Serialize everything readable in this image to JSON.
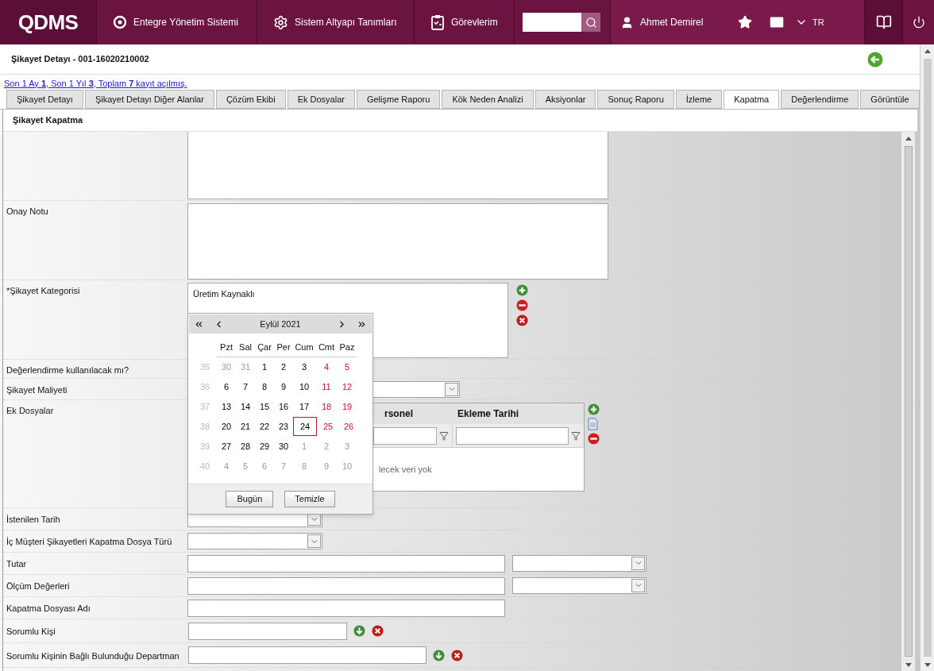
{
  "header": {
    "logo": "QDMS",
    "nav": [
      {
        "label": "Entegre Yönetim Sistemi"
      },
      {
        "label": "Sistem Altyapı Tanımları"
      },
      {
        "label": "Görevlerim"
      }
    ],
    "user": "Ahmet Demirel",
    "language": "TR"
  },
  "page": {
    "title": "Şikayet Detayı - 001-16020210002",
    "summary": "Son 1 Ay **1**, Son 1 Yıl **3**, Toplam **7** kayıt açılmış."
  },
  "tabs": [
    {
      "label": "Şikayet Detayı",
      "selected": false
    },
    {
      "label": "Şikayet Detayı Diğer Alanlar",
      "selected": false
    },
    {
      "label": "Çözüm Ekibi",
      "selected": false
    },
    {
      "label": "Ek Dosyalar",
      "selected": false
    },
    {
      "label": "Gelişme Raporu",
      "selected": false
    },
    {
      "label": "Kök Neden Analizi",
      "selected": false
    },
    {
      "label": "Aksiyonlar",
      "selected": false
    },
    {
      "label": "Sonuç Raporu",
      "selected": false
    },
    {
      "label": "İzleme",
      "selected": false
    },
    {
      "label": "Kapatma",
      "selected": true
    },
    {
      "label": "Değerlendirme",
      "selected": false
    },
    {
      "label": "Görüntüle",
      "selected": false
    }
  ],
  "section_title": "Şikayet Kapatma",
  "rows": [
    {
      "kind": "textarea"
    },
    {
      "kind": "textarea",
      "label": "Onay Notu"
    },
    {
      "kind": "listbox",
      "label": "*Şikayet Kategorisi",
      "items": [
        "Üretim Kaynaklı"
      ]
    },
    {
      "kind": "covered",
      "label": "Değerlendirme kullanılacak mı?"
    },
    {
      "kind": "select",
      "label": "Şikayet Maliyeti"
    },
    {
      "kind": "grid",
      "label": "Ek Dosyalar",
      "columns": [
        "rsonel",
        "Ekleme Tarihi"
      ],
      "empty_message": "lecek veri yok"
    },
    {
      "kind": "select_short",
      "label": "İstenilen Tarih"
    },
    {
      "kind": "select_short",
      "label": "İç Müşteri Şikayetleri Kapatma Dosya Türü"
    },
    {
      "kind": "input_select",
      "label": "Tutar"
    },
    {
      "kind": "input_select",
      "label": "Ölçüm Değerleri"
    },
    {
      "kind": "input",
      "label": "Kapatma Dosyası Adı"
    },
    {
      "kind": "lookup",
      "label": "Sorumlu Kişi"
    },
    {
      "kind": "lookup_wide",
      "label": "Sorumlu Kişinin Bağlı Bulunduğu Departman"
    }
  ],
  "calendar": {
    "month": "Eylül 2021",
    "weekdays": [
      "Pzt",
      "Sal",
      "Çar",
      "Per",
      "Cum",
      "Cmt",
      "Paz"
    ],
    "weeks": [
      {
        "number": "35",
        "days": [
          {
            "text": "30",
            "kind": "other",
            "selected": false
          },
          {
            "text": "31",
            "kind": "other",
            "selected": false
          },
          {
            "text": "1",
            "kind": "weekday",
            "selected": false
          },
          {
            "text": "2",
            "kind": "weekday",
            "selected": false
          },
          {
            "text": "3",
            "kind": "weekday",
            "selected": false
          },
          {
            "text": "4",
            "kind": "weekend",
            "selected": false
          },
          {
            "text": "5",
            "kind": "weekend",
            "selected": false
          }
        ]
      },
      {
        "number": "36",
        "days": [
          {
            "text": "6",
            "kind": "weekday",
            "selected": false
          },
          {
            "text": "7",
            "kind": "weekday",
            "selected": false
          },
          {
            "text": "8",
            "kind": "weekday",
            "selected": false
          },
          {
            "text": "9",
            "kind": "weekday",
            "selected": false
          },
          {
            "text": "10",
            "kind": "weekday",
            "selected": false
          },
          {
            "text": "11",
            "kind": "weekend",
            "selected": false
          },
          {
            "text": "12",
            "kind": "weekend",
            "selected": false
          }
        ]
      },
      {
        "number": "37",
        "days": [
          {
            "text": "13",
            "kind": "weekday",
            "selected": false
          },
          {
            "text": "14",
            "kind": "weekday",
            "selected": false
          },
          {
            "text": "15",
            "kind": "weekday",
            "selected": false
          },
          {
            "text": "16",
            "kind": "weekday",
            "selected": false
          },
          {
            "text": "17",
            "kind": "weekday",
            "selected": false
          },
          {
            "text": "18",
            "kind": "weekend",
            "selected": false
          },
          {
            "text": "19",
            "kind": "weekend",
            "selected": false
          }
        ]
      },
      {
        "number": "38",
        "days": [
          {
            "text": "20",
            "kind": "weekday",
            "selected": false
          },
          {
            "text": "21",
            "kind": "weekday",
            "selected": false
          },
          {
            "text": "22",
            "kind": "weekday",
            "selected": false
          },
          {
            "text": "23",
            "kind": "weekday",
            "selected": false
          },
          {
            "text": "24",
            "kind": "weekday",
            "selected": true
          },
          {
            "text": "25",
            "kind": "weekend",
            "selected": false
          },
          {
            "text": "26",
            "kind": "weekend",
            "selected": false
          }
        ]
      },
      {
        "number": "39",
        "days": [
          {
            "text": "27",
            "kind": "weekday",
            "selected": false
          },
          {
            "text": "28",
            "kind": "weekday",
            "selected": false
          },
          {
            "text": "29",
            "kind": "weekday",
            "selected": false
          },
          {
            "text": "30",
            "kind": "weekday",
            "selected": false
          },
          {
            "text": "1",
            "kind": "other",
            "selected": false
          },
          {
            "text": "2",
            "kind": "other",
            "selected": false
          },
          {
            "text": "3",
            "kind": "other",
            "selected": false
          }
        ]
      },
      {
        "number": "40",
        "days": [
          {
            "text": "4",
            "kind": "other",
            "selected": false
          },
          {
            "text": "5",
            "kind": "other",
            "selected": false
          },
          {
            "text": "6",
            "kind": "other",
            "selected": false
          },
          {
            "text": "7",
            "kind": "other",
            "selected": false
          },
          {
            "text": "8",
            "kind": "other",
            "selected": false
          },
          {
            "text": "9",
            "kind": "other",
            "selected": false
          },
          {
            "text": "10",
            "kind": "other",
            "selected": false
          }
        ]
      }
    ],
    "buttons": [
      "Bugün",
      "Temizle"
    ]
  }
}
